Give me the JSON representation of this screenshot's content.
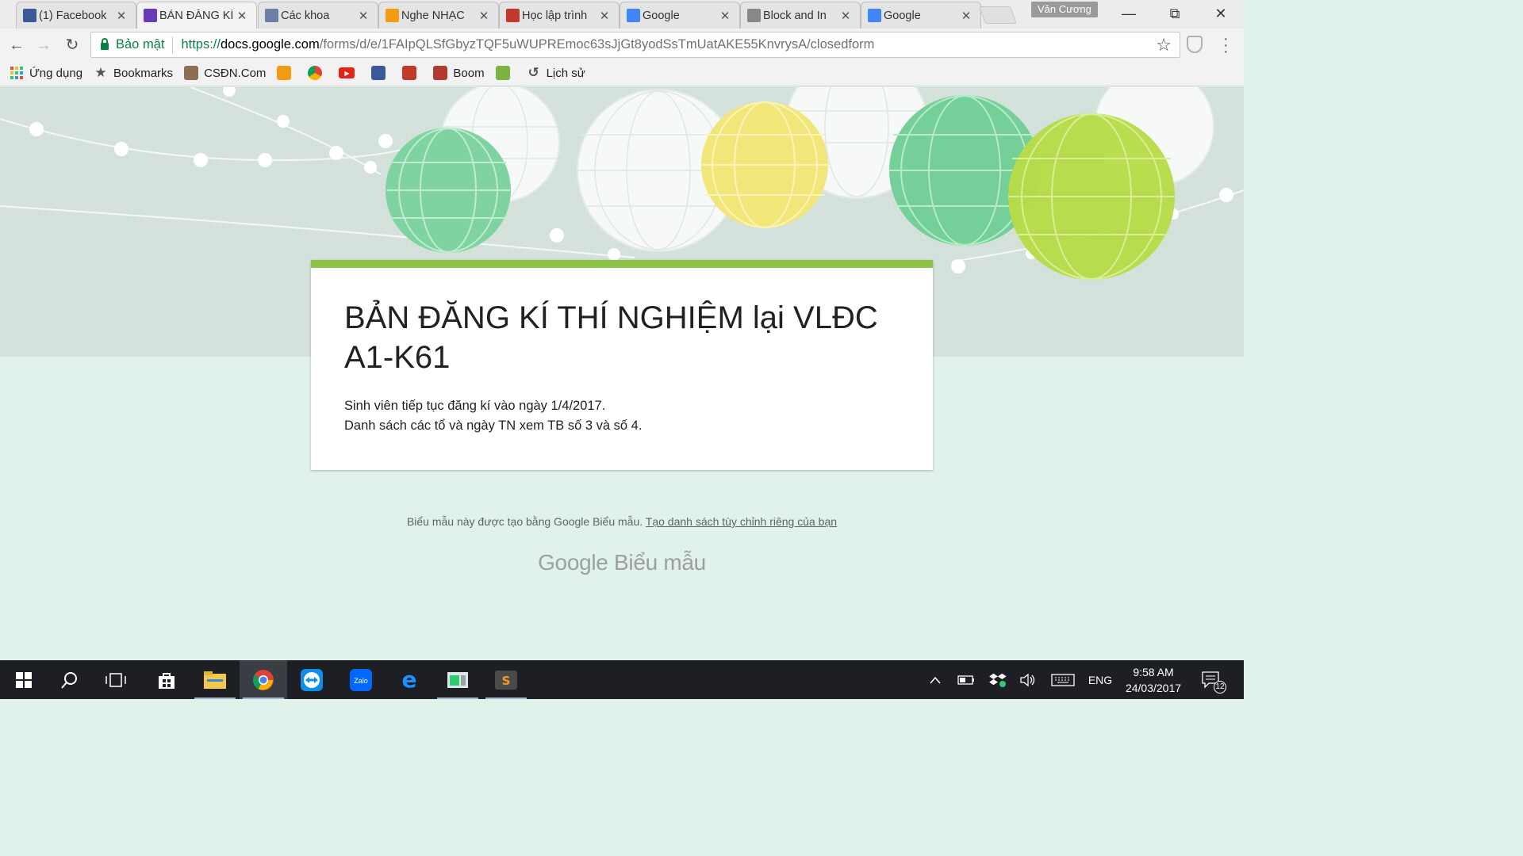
{
  "browser": {
    "tabs": [
      {
        "title": "(1) Facebook",
        "favicon": "facebook-icon",
        "color": "#3b5998"
      },
      {
        "title": "BẢN ĐĂNG KÍ",
        "favicon": "google-forms-icon",
        "color": "#673ab7",
        "active": true
      },
      {
        "title": "Các khoa",
        "favicon": "site-icon",
        "color": "#6a7ea8"
      },
      {
        "title": "Nghe NHẠC",
        "favicon": "nhac-icon",
        "color": "#f39c12"
      },
      {
        "title": "Học lập trình",
        "favicon": "e-icon",
        "color": "#c0392b"
      },
      {
        "title": "Google",
        "favicon": "google-icon",
        "color": "#4285f4"
      },
      {
        "title": "Block and In",
        "favicon": "document-icon",
        "color": "#888888"
      },
      {
        "title": "Google",
        "favicon": "google-icon",
        "color": "#4285f4"
      }
    ],
    "profile_name": "Văn Cương",
    "security_label": "Bảo mật",
    "url_scheme": "https://",
    "url_host": "docs.google.com",
    "url_path": "/forms/d/e/1FAIpQLSfGbyzTQF5uWUPREmoc63sJjGt8yodSsTmUatAKE55KnvrysA/closedform",
    "bookmarks": [
      {
        "label": "Ứng dụng",
        "icon": "apps-grid-icon"
      },
      {
        "label": "Bookmarks",
        "icon": "star-icon"
      },
      {
        "label": "CSĐN.Com",
        "icon": "csdn-icon"
      },
      {
        "label": "",
        "icon": "nhac-icon"
      },
      {
        "label": "",
        "icon": "chrome-webstore-icon"
      },
      {
        "label": "",
        "icon": "youtube-icon"
      },
      {
        "label": "",
        "icon": "facebook-icon"
      },
      {
        "label": "",
        "icon": "14-icon"
      },
      {
        "label": "Boom",
        "icon": "boom-icon"
      },
      {
        "label": "",
        "icon": "v-icon"
      },
      {
        "label": "Lịch sử",
        "icon": "history-icon"
      }
    ]
  },
  "form": {
    "title": "BẢN ĐĂNG KÍ THÍ NGHIỆM lại VLĐC A1-K61",
    "description_line1": "Sinh viên tiếp tục đăng kí vào ngày 1/4/2017.",
    "description_line2": "Danh sách các tổ và ngày TN xem TB số 3 và số 4.",
    "accent_color": "#8bc34a"
  },
  "footer": {
    "text": "Biểu mẫu này được tạo bằng Google Biểu mẫu.",
    "link_text": "Tạo danh sách tùy chỉnh riêng của bạn",
    "brand_google": "Google",
    "brand_product": "Biểu mẫu"
  },
  "taskbar": {
    "language": "ENG",
    "time": "9:58 AM",
    "date": "24/03/2017",
    "notification_count": "12"
  }
}
